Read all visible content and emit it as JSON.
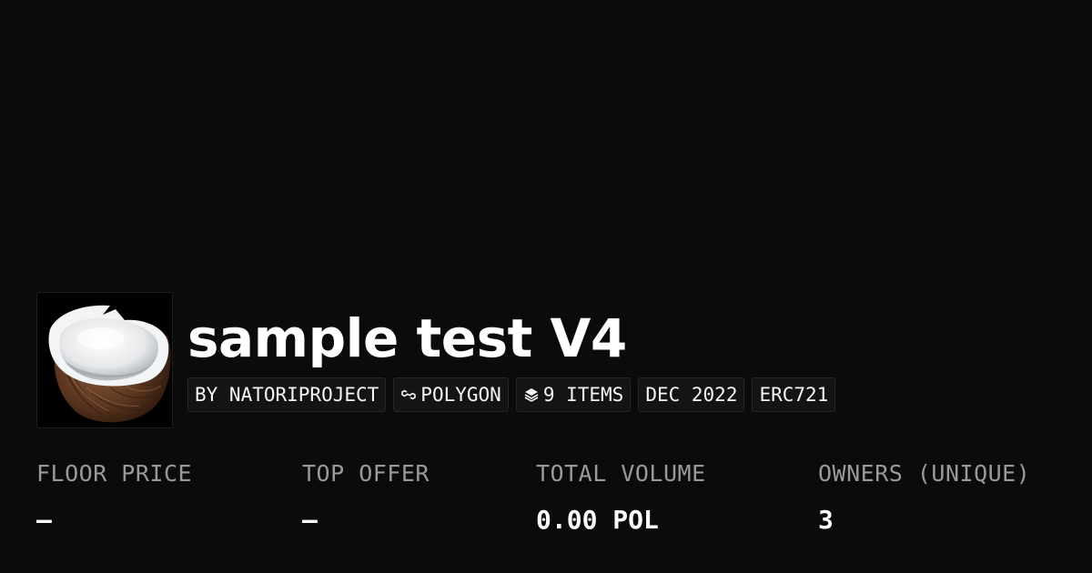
{
  "collection": {
    "title": "sample test V4",
    "avatar_icon": "coconut-image"
  },
  "chips": {
    "creator": "BY NATORIPROJECT",
    "chain": "POLYGON",
    "chain_icon": "polygon-chain-icon",
    "items": "9 ITEMS",
    "items_icon": "layers-icon",
    "date": "DEC 2022",
    "standard": "ERC721"
  },
  "stats": {
    "floor_price": {
      "label": "FLOOR PRICE",
      "value": "–"
    },
    "top_offer": {
      "label": "TOP OFFER",
      "value": "–"
    },
    "total_volume": {
      "label": "TOTAL VOLUME",
      "value": "0.00 POL"
    },
    "owners": {
      "label": "OWNERS (UNIQUE)",
      "value": "3"
    }
  },
  "colors": {
    "background": "#0b0b0b",
    "text": "#ffffff",
    "label": "#9a9a9a",
    "chip_bg": "#141414",
    "chip_border": "#262626"
  }
}
